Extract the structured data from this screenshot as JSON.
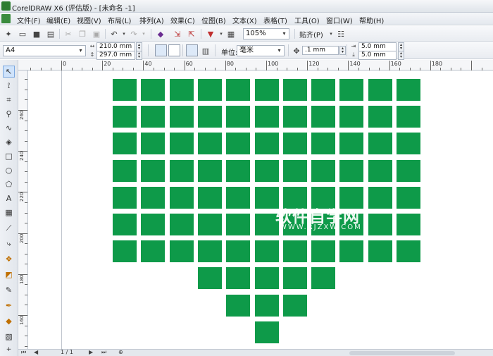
{
  "window": {
    "title": "CorelDRAW X6 (评估版) - [未命名 -1]"
  },
  "menu": [
    "文件(F)",
    "编辑(E)",
    "视图(V)",
    "布局(L)",
    "排列(A)",
    "效果(C)",
    "位图(B)",
    "文本(X)",
    "表格(T)",
    "工具(O)",
    "窗口(W)",
    "帮助(H)"
  ],
  "toolbar": {
    "zoom": "105%",
    "snap": "贴齐(P)"
  },
  "property_bar": {
    "paper": "A4",
    "width": "210.0 mm",
    "height": "297.0 mm",
    "unit_label": "单位:",
    "unit": "毫米",
    "nudge": ".1 mm",
    "dup_x": "5.0 mm",
    "dup_y": "5.0 mm"
  },
  "ruler_h_labels": [
    "0",
    "20",
    "40",
    "60",
    "80",
    "100",
    "120",
    "140",
    "160",
    "180"
  ],
  "ruler_v_labels": [
    "260",
    "240",
    "220",
    "200",
    "180",
    "160",
    "140"
  ],
  "statusbar": {
    "pages": "1 / 1"
  },
  "watermark": {
    "main": "软件自学网",
    "sub": "WWW.RJZXW.COM"
  },
  "colors": {
    "square": "#0e9a49"
  }
}
